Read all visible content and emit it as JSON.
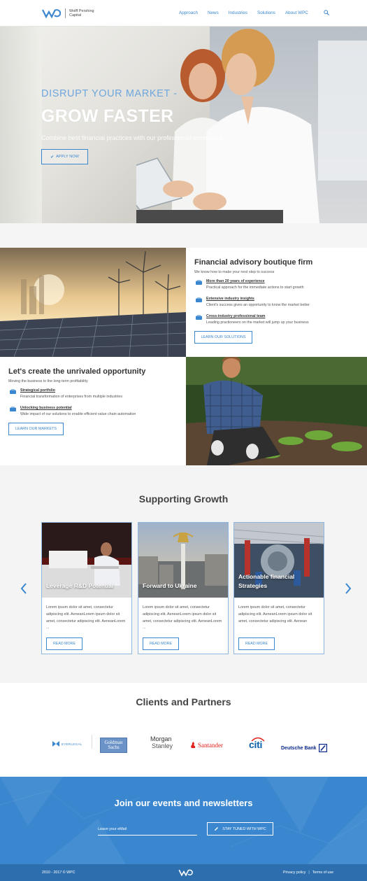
{
  "brand": {
    "name_line1": "Wolff Pershing",
    "name_line2": "Capital",
    "logo_text": "WPC"
  },
  "nav": [
    "Approach",
    "News",
    "Industries",
    "Solutions",
    "About WPC"
  ],
  "hero": {
    "line1": "DISRUPT YOUR MARKET -",
    "line2": "GROW FASTER",
    "line3": "Combine best financial practices with our professional excellence",
    "button": "APPLY NOW"
  },
  "feature1": {
    "title": "Financial advisory boutique firm",
    "subtitle": "We know how to make your next step to success",
    "items": [
      {
        "title": "More than 20 years of experience",
        "desc": "Practical approach for the immediate actions to start growth"
      },
      {
        "title": "Extensive industry insights",
        "desc": "Client's success gives an opportunity to know the market better"
      },
      {
        "title": "Cross-industry professional team",
        "desc": "Leading practioneers on the market will jump up your business"
      }
    ],
    "button": "LEARN OUR SOLUTIONS"
  },
  "feature2": {
    "title": "Let's create the unrivaled opportunity",
    "subtitle": "Moving the business to the long-term profitability",
    "items": [
      {
        "title": "Strategical portfolio",
        "desc": "Financial transformation of enterprises from multiple industries"
      },
      {
        "title": "Unlocking business potential",
        "desc": "Wide impact of our solutions to enable efficient value chain automation"
      }
    ],
    "button": "LEARN OUR MARKETS"
  },
  "growth": {
    "title": "Supporting Growth",
    "cards": [
      {
        "caption": "Leverage R&D Potential",
        "text": "Lorem ipsum dolor sit amet, consectetur adipiscing elit. AeneanLorem ipsum dolor sit amet, consectetur adipiscing elit. AeneanLorem ...",
        "button": "READ MORE"
      },
      {
        "caption": "Forward to Ukraine",
        "text": "Lorem ipsum dolor sit amet, consectetur adipiscing elit. AeneanLorem ipsum dolor sit amet, consectetur adipiscing elit. AeneanLorem ...",
        "button": "READ MORE"
      },
      {
        "caption": "Actionable financial Strategies",
        "text": "Lorem ipsum dolor sit amet, consectetur adipiscing elit. AeneanLorem ipsum dolor sit amet, consectetur adipiscing elit. Aenean",
        "button": "READ MORE"
      }
    ]
  },
  "clients": {
    "title": "Clients and Partners",
    "logos": {
      "everlegal": "EVERLEGAL",
      "goldman": [
        "Goldman",
        "Sachs"
      ],
      "morgan": [
        "Morgan",
        "Stanley"
      ],
      "santander": "Santander",
      "citi": "citi",
      "deutsche": "Deutsche Bank"
    }
  },
  "newsletter": {
    "title": "Join our events and newsletters",
    "input_placeholder": "Leave your eMail",
    "button": "STAY TUNED WITH WPC"
  },
  "footer": {
    "copyright": "2010 - 2017 © WPC",
    "links": [
      "Privacy policy",
      "Terms of use"
    ]
  },
  "colors": {
    "accent": "#3a87cf",
    "newsletter_bg": "#3a87cf",
    "footer_bg": "#2d6fae",
    "santander": "#e0201b",
    "citi_blue": "#0b5fa8",
    "deutsche_blue": "#0b2a8a",
    "goldman_blue": "#6c93c7"
  },
  "icons": {
    "search": "search-icon",
    "check": "check-icon",
    "briefcase": "briefcase-icon",
    "pencil": "pencil-icon",
    "arrow_left": "chevron-left-icon",
    "arrow_right": "chevron-right-icon"
  }
}
